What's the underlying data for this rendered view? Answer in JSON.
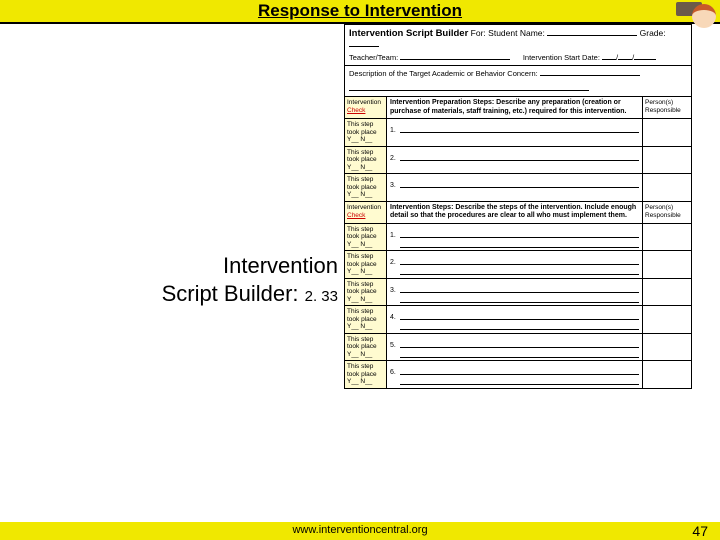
{
  "header": {
    "title": "Response to Intervention"
  },
  "caption": {
    "line1": "Intervention",
    "line2a": "Script Builder: ",
    "line2b": "2. 33"
  },
  "form": {
    "title": "Intervention Script Builder",
    "for_label": "For:",
    "student_label": "Student Name:",
    "grade_label": "Grade:",
    "teacher_label": "Teacher/Team:",
    "startdate_label": "Intervention Start Date:",
    "date_sep": "/",
    "desc_label": "Description of the Target Academic or Behavior Concern:",
    "check_hdr1": "Intervention",
    "check_hdr2": "Check",
    "prep_hdr": "Intervention Preparation Steps: Describe any preparation (creation or purchase of materials, staff training, etc.) required for this intervention.",
    "steps_hdr": "Intervention Steps: Describe the steps of the intervention. Include enough detail so that the procedures are clear to all who must implement them.",
    "resp_hdr": "Person(s) Responsible",
    "step_note1": "This step",
    "step_note2": "took place",
    "step_note3": "Y__ N__",
    "nums": [
      "1.",
      "2.",
      "3.",
      "4.",
      "5.",
      "6."
    ]
  },
  "footer": {
    "url": "www.interventioncentral.org",
    "page": "47"
  }
}
